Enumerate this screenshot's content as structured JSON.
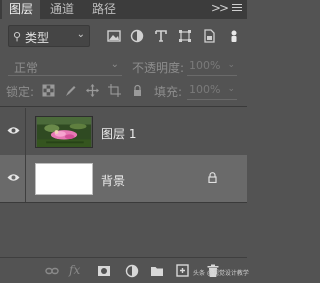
{
  "panel": {
    "tabs": [
      {
        "label": "图层",
        "active": true
      },
      {
        "label": "通道",
        "active": false
      },
      {
        "label": "路径",
        "active": false
      }
    ],
    "overflow_label": ">>"
  },
  "filter": {
    "kind_label": "类型",
    "icons": [
      "image-filter-icon",
      "adjustment-filter-icon",
      "type-filter-icon",
      "shape-filter-icon",
      "smart-object-filter-icon",
      "filter-toggle-icon"
    ]
  },
  "blend": {
    "mode": "正常",
    "opacity_label": "不透明度:",
    "opacity_value": "100%"
  },
  "lock": {
    "label": "锁定:",
    "fill_label": "填充:",
    "fill_value": "100%"
  },
  "layers": [
    {
      "name": "图层 1",
      "visible": true,
      "thumbnail": "photo",
      "selected": false,
      "locked": false
    },
    {
      "name": "背景",
      "visible": true,
      "thumbnail": "white",
      "selected": true,
      "locked": true
    }
  ],
  "footer": {
    "fx_label": "fx",
    "watermark": "头条 @视觉设计教学"
  },
  "colors": {
    "panel_bg": "#535353",
    "tabbar_bg": "#3c3c3c",
    "selected_row": "#6a6a6a"
  }
}
